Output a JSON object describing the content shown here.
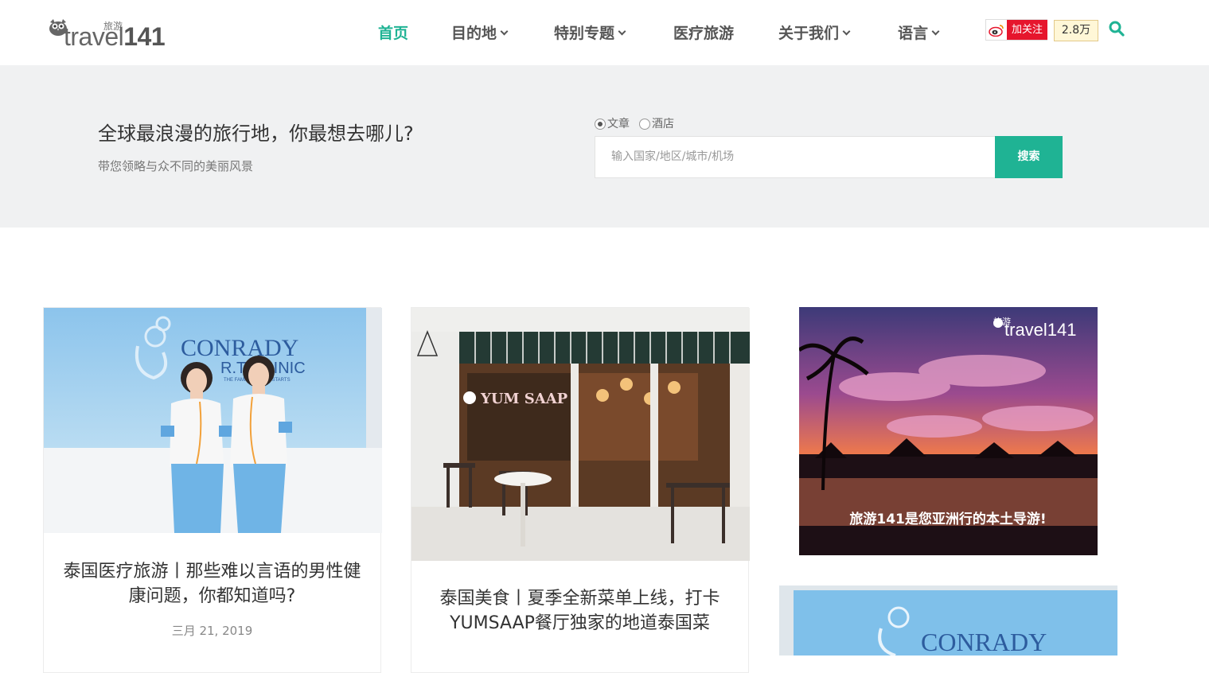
{
  "header": {
    "logo": {
      "brand": "travel",
      "number": "141",
      "cn": "旅游"
    },
    "nav": [
      {
        "label": "首页",
        "dropdown": false,
        "active": true
      },
      {
        "label": "目的地",
        "dropdown": true,
        "active": false
      },
      {
        "label": "特别专题",
        "dropdown": true,
        "active": false
      },
      {
        "label": "医疗旅游",
        "dropdown": false,
        "active": false
      },
      {
        "label": "关于我们",
        "dropdown": true,
        "active": false
      },
      {
        "label": "语言",
        "dropdown": true,
        "active": false
      }
    ],
    "weibo": {
      "follow_label": "加关注",
      "fans_count": "2.8万"
    },
    "search_icon": "search-icon"
  },
  "hero": {
    "title": "全球最浪漫的旅行地，你最想去哪儿?",
    "subtitle": "带您领略与众不同的美丽风景",
    "search_types": [
      {
        "label": "文章",
        "checked": true
      },
      {
        "label": "酒店",
        "checked": false
      }
    ],
    "search_placeholder": "输入国家/地区/城市/机场",
    "search_button": "搜索"
  },
  "cards": [
    {
      "image_text": [
        "CONRADY",
        "R.T. CLINIC",
        "THE FAMILY BEGINS STARTS"
      ],
      "title": "泰国医疗旅游丨那些难以言语的男性健康问题，你都知道吗?",
      "date": "三月 21, 2019"
    },
    {
      "image_text": [
        "YUM SAAP"
      ],
      "title": "泰国美食丨夏季全新菜单上线，打卡YUMSAAP餐厅独家的地道泰国菜",
      "date": ""
    }
  ],
  "ads": [
    {
      "logo_cn": "旅游",
      "logo_brand": "travel141",
      "caption": "旅游141是您亚洲行的本土导游!"
    },
    {
      "image_text": "CONRADY"
    }
  ],
  "colors": {
    "accent": "#1fb394",
    "weibo_red": "#e6162d",
    "hero_bg": "#f0f1f2"
  }
}
